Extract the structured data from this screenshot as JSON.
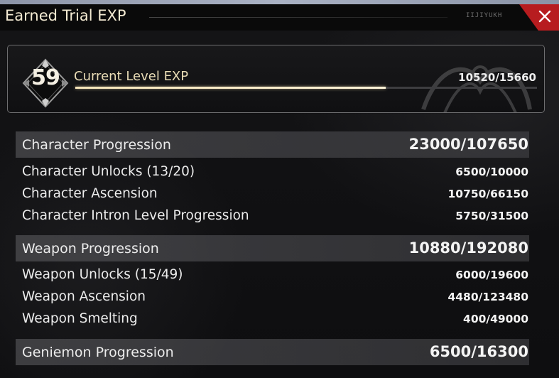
{
  "window": {
    "title": "Earned Trial EXP",
    "code": "ᴵᴵᴶᴵᵞᵘᴷᴴ"
  },
  "colors": {
    "close": "#b71c1f",
    "title": "#f3ead2",
    "bar_fill": "#f4e3b8"
  },
  "level": {
    "number": "59",
    "label": "Current Level EXP",
    "value": "10520/15660",
    "progress": 0.6718
  },
  "character": {
    "label": "Character Progression",
    "value": "23000/107650",
    "items": [
      {
        "label": "Character Unlocks (13/20)",
        "value": "6500/10000"
      },
      {
        "label": "Character Ascension",
        "value": "10750/66150"
      },
      {
        "label": "Character Intron Level Progression",
        "value": "5750/31500"
      }
    ]
  },
  "weapon": {
    "label": "Weapon Progression",
    "value": "10880/192080",
    "items": [
      {
        "label": "Weapon Unlocks (15/49)",
        "value": "6000/19600"
      },
      {
        "label": "Weapon Ascension",
        "value": "4480/123480"
      },
      {
        "label": "Weapon Smelting",
        "value": "400/49000"
      }
    ]
  },
  "geniemon": {
    "label": "Geniemon Progression",
    "value": "6500/16300"
  }
}
